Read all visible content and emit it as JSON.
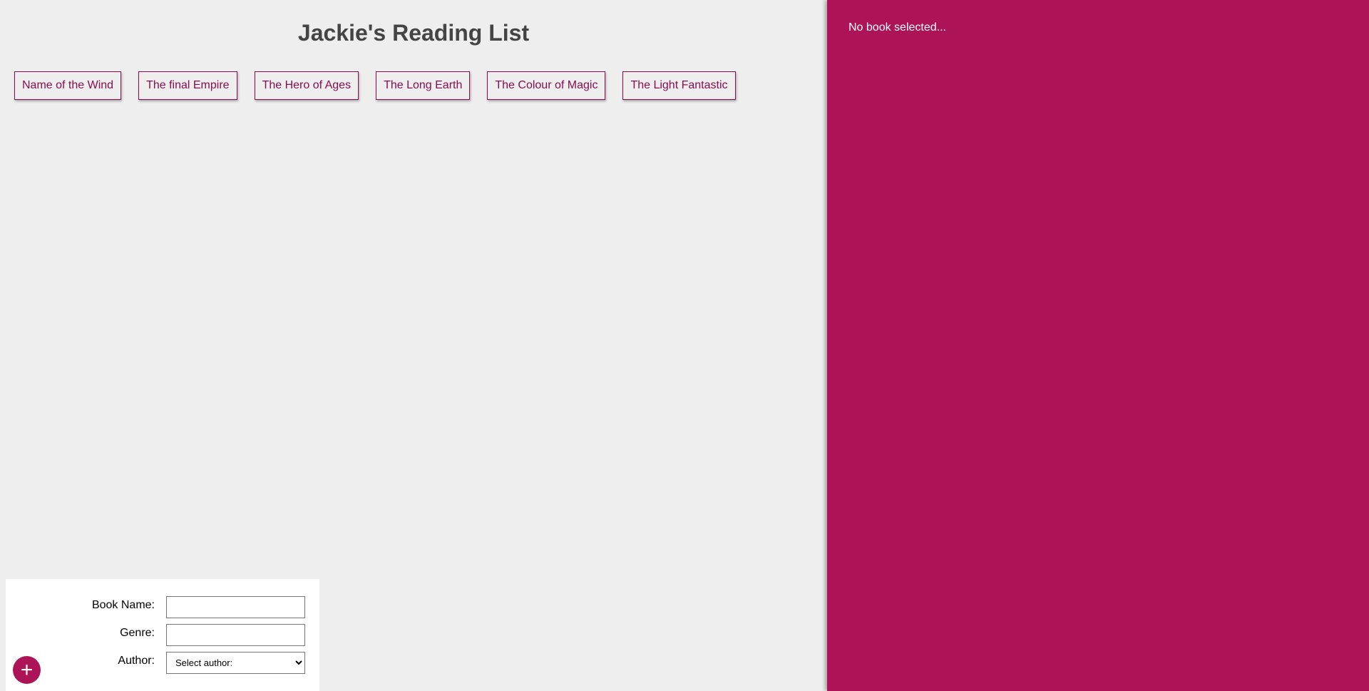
{
  "page": {
    "title": "Jackie's Reading List"
  },
  "books": [
    {
      "label": "Name of the Wind"
    },
    {
      "label": "The final Empire"
    },
    {
      "label": "The Hero of Ages"
    },
    {
      "label": "The Long Earth"
    },
    {
      "label": "The Colour of Magic"
    },
    {
      "label": "The Light Fantastic"
    }
  ],
  "details": {
    "empty_text": "No book selected..."
  },
  "form": {
    "book_name_label": "Book Name:",
    "book_name_value": "",
    "genre_label": "Genre:",
    "genre_value": "",
    "author_label": "Author:",
    "author_selected": "Select author:"
  },
  "add_button": {
    "icon": "plus-icon",
    "label": "+"
  },
  "colors": {
    "accent": "#ad1457",
    "book_text": "#880e4f",
    "background": "#eeeeee",
    "heading": "#444444"
  }
}
